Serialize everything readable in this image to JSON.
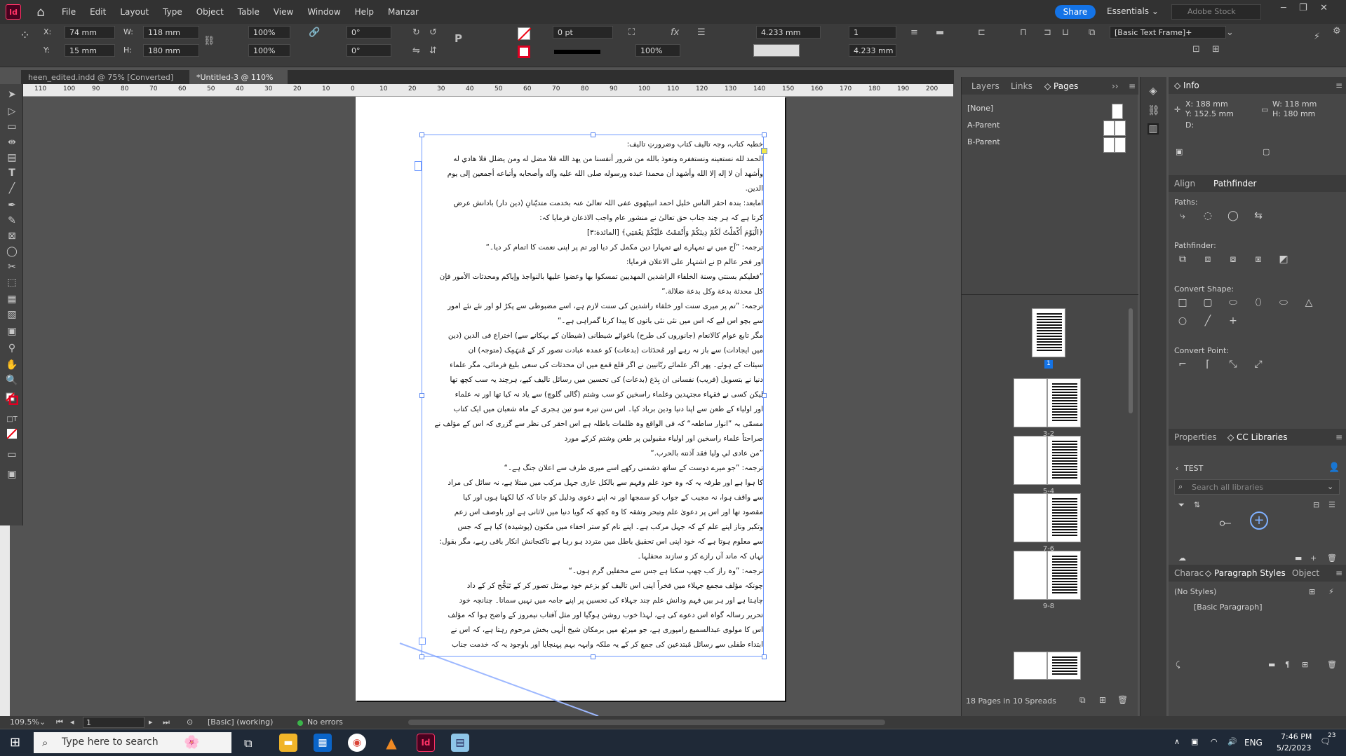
{
  "app": {
    "logo": "Id",
    "menu": [
      "File",
      "Edit",
      "Layout",
      "Type",
      "Object",
      "Table",
      "View",
      "Window",
      "Help",
      "Manzar"
    ],
    "share_label": "Share",
    "workspace": "Essentials",
    "stock_placeholder": "Adobe Stock"
  },
  "control": {
    "x_label": "X:",
    "x_value": "74 mm",
    "y_label": "Y:",
    "y_value": "15 mm",
    "w_label": "W:",
    "w_value": "118 mm",
    "h_label": "H:",
    "h_value": "180 mm",
    "scale_x": "100%",
    "scale_y": "100%",
    "rotate": "0°",
    "shear": "0°",
    "stroke_weight": "0 pt",
    "opacity": "100%",
    "spacing_a": "4.233 mm",
    "spacing_b": "4.233 mm",
    "columns": "1",
    "object_style": "[Basic Text Frame]+"
  },
  "tabs": [
    {
      "label": "heen_edited.indd @ 75% [Converted]"
    },
    {
      "label": "*Untitled-3 @ 110%"
    }
  ],
  "ruler_ticks": [
    "110",
    "100",
    "90",
    "80",
    "70",
    "60",
    "50",
    "40",
    "30",
    "20",
    "10",
    "0",
    "10",
    "20",
    "30",
    "40",
    "50",
    "60",
    "70",
    "80",
    "90",
    "100",
    "110",
    "120",
    "130",
    "140",
    "150",
    "160",
    "170",
    "180",
    "190",
    "200"
  ],
  "document_lines": [
    "خطبہ کتاب، وجہ تالیف کتاب وضرورتِ تالیف:",
    "الحمد لله نستعينه ونستغفره ونعوذ بالله من شرور أنفسنا من يهد الله فلا مضل له ومن يضلل فلا هادي له",
    "وأشهد أن لا إله إلا الله وأشهد أن محمدا عبده ورسوله صلى الله عليه وآله وأصحابه وأتباعه أجمعين إلى يوم",
    "الدين.",
    "امابعد: بندہ احقر الناس خلیل احمد انبیٹھوی عفی اللہ تعالیٰ عنہ بخدمت متدیّنانِ (دین دار) بادانش عرض",
    "کرتا ہے کہ ہر چند جناب حق تعالیٰ نے منشور عام واجب الاذعان فرمایا کہ:",
    "﴿الْيَوْمَ أَكْمَلْتُ لَكُمْ دِينَكُمْ وَأَتْمَمْتُ عَلَيْكُمْ نِعْمَتِي﴾ [المائدة:۳]",
    "ترجمہ: ”آج میں نے تمہارے لیے تمہارا دین مکمل کر دیا اور تم پر اپنی نعمت کا اتمام کر دیا۔“",
    "اور فخر عالم p نے اشتہار علی الاعلان فرمایا:",
    "”فعليكم بسنتي وسنة الخلفاء الراشدين المهديين تمسكوا بها وعضوا عليها بالنواجذ وإياكم ومحدثات الأمور فإن",
    "كل محدثة بدعة وكل بدعة ضلالة.“",
    "ترجمہ: ”تم پر میری سنت اور خلفاء راشدین کی سنت لازم ہے، اسے مضبوطی سے پکڑ لو اور نئے نئے امور",
    "سے بچو اس لیے کہ اس میں نئی نئی باتوں کا پیدا کرنا گمراہی ہے۔“",
    "مگر تابع عوام کالانعام (جانوروں کی طرح) باغوائے شیطانی (شیطان کے بہکانے سے) اختراع فی الدین (دین",
    "میں ایجادات) سے باز نہ رہے اور مُحدَثات (بدعات) کو عمدہ عبادت تصور کر کے مُنہَمِک (متوجہ) ان",
    "سیئات کے ہوئے۔ پھر اگر علمائے ربّانیین نے اگر قلع قمع میں ان محدثات کی سعی بلیغ فرمائی، مگر علماء",
    "دنیا نے بتسویل (فریب) نفسانی ان بِدَع (بدعات) کی تحسین میں رسائل تالیف کیے، ہرچند یہ سب کچھ تھا",
    "لیکن کسی نے فقہاء مجتہدین وعلماء راسخین کو سب وشتم (گالی گلوچ) سے یاد نہ کیا تھا اور نہ علماء",
    "اور اولیاء کے طعن سے اپنا دنیا ودین برباد کیا۔ اس سن تیرہ سو تین ہجری کے ماہ شعبان میں ایک کتاب",
    "مسمّٰی بہ ”انوار ساطعہ“ کہ فی الواقع وہ ظلمات باطلہ ہے اس احقر کی نظر سے گزری کہ اس کے مؤلف نے",
    "صراحتاً علماء راسخین اور اولیاء مقبولین پر طعن وشتم کرکے مورد",
    "”من عادی لي وليا فقد آذنته بالحرب.“",
    "ترجمہ: ”جو میرے دوست کے ساتھ دشمنی رکھے اسے میری طرف سے اعلان جنگ ہے۔“",
    "کا ہوا ہے اور طرفہ یہ کہ وہ خود علم وفہم سے بالکل عاری جہل مرکب میں مبتلا ہے، نہ سائل کی مراد",
    "سے واقف ہوا، نہ مجیب کے جواب کو سمجھا اور نہ اپنے دعوی ودلیل کو جانا کہ کیا لکھنا ہوں اور کیا",
    "مقصود تھا اور اس پر دعویٰ علم وتبحر وتفقہ کا وہ کچھ کہ گویا دنیا میں لاثانی ہے اور باوصف اس زعم",
    "وتکبر وناز اپنے علم کے کہ جہل مرکب ہے۔ اپنے نام کو ستر اخفاء میں مکنون (پوشیدہ) کیا ہے کہ جس",
    "سے معلوم ہوتا ہے کہ خود اپنی اس تحقیق باطل میں متردد ہو رہا ہے تاکتجانش انکار باقی رہے، مگر بقول:",
    "نہاں کہ ماند آں رازے کز و سازند محفلہا۔",
    "ترجمہ: ”وہ راز کب چھپ سکتا ہے جس سے محفلیں گرم ہوں۔“",
    "چونکہ مؤلف مجمع جہلاء میں فخراً اپنی اس تالیف کو بزعم خود بےمثل تصور کر کے تَبَجُّح کر کے داد",
    "چاہتا ہے اور ہر بیں فہم ودانش علم چند جہلاء کی تحسین پر اپنے جامہ میں نہیں سماتا۔ چنانچہ خود",
    "تحریر رسالہ گواہ اس دعوے کی ہے، لہذا خوب روشن ہوگیا اور مثل آفتاب نیمروز کے واضح ہوا کہ مؤلف",
    "اس کا مولوی عبدالسمیع رامپوری ہے، جو میرٹھ میں برمکان شیخ الٰہی بخش مرحوم رہتا ہے، کہ اس نے",
    "ابتداء طفلی سے رسائل مُبتدعین کی جمع کر کے یہ ملکہ وابہہ بہم پہنچایا اور باوجود یہ کہ خدمت جناب"
  ],
  "pages_panel": {
    "tabs": [
      "Layers",
      "Links",
      "Pages"
    ],
    "masters": [
      "[None]",
      "A-Parent",
      "B-Parent"
    ],
    "spreads": [
      "1",
      "3-2",
      "5-4",
      "7-6",
      "9-8"
    ],
    "footer": "18 Pages in 10 Spreads"
  },
  "info_panel": {
    "title": "Info",
    "x": "X: 188 mm",
    "y": "Y: 152.5 mm",
    "d": "D:",
    "w": "W: 118 mm",
    "h": "H: 180 mm"
  },
  "align_panel": {
    "tabs": [
      "Align",
      "Pathfinder"
    ],
    "paths_label": "Paths:",
    "pathfinder_label": "Pathfinder:",
    "convert_shape_label": "Convert Shape:",
    "convert_point_label": "Convert Point:"
  },
  "libraries_panel": {
    "tabs": [
      "Properties",
      "CC Libraries"
    ],
    "library": "TEST",
    "search_placeholder": "Search all libraries"
  },
  "styles_panel": {
    "tabs": [
      "Charac",
      "Paragraph Styles",
      "Object"
    ],
    "items": [
      "(No Styles)",
      "[Basic Paragraph]"
    ]
  },
  "status": {
    "zoom": "109.5%",
    "page": "1",
    "preflight_profile": "[Basic] (working)",
    "errors": "No errors"
  },
  "taskbar": {
    "search_placeholder": "Type here to search",
    "lang": "ENG",
    "time": "7:46 PM",
    "date": "5/2/2023",
    "notifications": "23"
  }
}
